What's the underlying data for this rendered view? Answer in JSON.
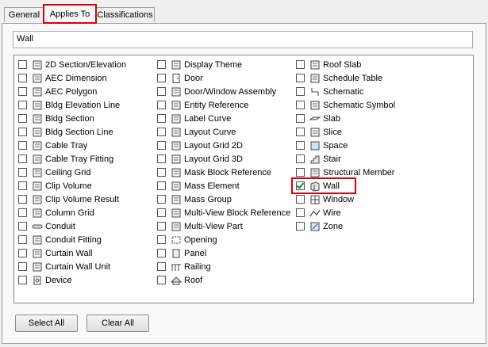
{
  "tabs": [
    "General",
    "Applies To",
    "Classifications"
  ],
  "filter_value": "Wall",
  "columns": [
    [
      {
        "label": "2D Section/Elevation",
        "icon": "section-elevation-icon",
        "checked": false
      },
      {
        "label": "AEC Dimension",
        "icon": "dimension-icon",
        "checked": false
      },
      {
        "label": "AEC Polygon",
        "icon": "polygon-icon",
        "checked": false
      },
      {
        "label": "Bldg Elevation Line",
        "icon": "elevation-line-icon",
        "checked": false
      },
      {
        "label": "Bldg Section",
        "icon": "bldg-section-icon",
        "checked": false
      },
      {
        "label": "Bldg Section Line",
        "icon": "section-line-icon",
        "checked": false
      },
      {
        "label": "Cable Tray",
        "icon": "cable-tray-icon",
        "checked": false
      },
      {
        "label": "Cable Tray Fitting",
        "icon": "cable-tray-fitting-icon",
        "checked": false
      },
      {
        "label": "Ceiling Grid",
        "icon": "ceiling-grid-icon",
        "checked": false
      },
      {
        "label": "Clip Volume",
        "icon": "clip-volume-icon",
        "checked": false
      },
      {
        "label": "Clip Volume Result",
        "icon": "clip-volume-result-icon",
        "checked": false
      },
      {
        "label": "Column Grid",
        "icon": "column-grid-icon",
        "checked": false
      },
      {
        "label": "Conduit",
        "icon": "conduit-icon",
        "checked": false
      },
      {
        "label": "Conduit Fitting",
        "icon": "conduit-fitting-icon",
        "checked": false
      },
      {
        "label": "Curtain Wall",
        "icon": "curtain-wall-icon",
        "checked": false
      },
      {
        "label": "Curtain Wall Unit",
        "icon": "curtain-wall-unit-icon",
        "checked": false
      },
      {
        "label": "Device",
        "icon": "device-icon",
        "checked": false
      }
    ],
    [
      {
        "label": "Display Theme",
        "icon": "display-theme-icon",
        "checked": false
      },
      {
        "label": "Door",
        "icon": "door-icon",
        "checked": false
      },
      {
        "label": "Door/Window Assembly",
        "icon": "door-window-assembly-icon",
        "checked": false
      },
      {
        "label": "Entity Reference",
        "icon": "entity-reference-icon",
        "checked": false
      },
      {
        "label": "Label Curve",
        "icon": "label-curve-icon",
        "checked": false
      },
      {
        "label": "Layout Curve",
        "icon": "layout-curve-icon",
        "checked": false
      },
      {
        "label": "Layout Grid 2D",
        "icon": "layout-grid-2d-icon",
        "checked": false
      },
      {
        "label": "Layout Grid 3D",
        "icon": "layout-grid-3d-icon",
        "checked": false
      },
      {
        "label": "Mask Block Reference",
        "icon": "mask-block-icon",
        "checked": false
      },
      {
        "label": "Mass Element",
        "icon": "mass-element-icon",
        "checked": false
      },
      {
        "label": "Mass Group",
        "icon": "mass-group-icon",
        "checked": false
      },
      {
        "label": "Multi-View Block Reference",
        "icon": "multi-view-block-icon",
        "checked": false
      },
      {
        "label": "Multi-View Part",
        "icon": "multi-view-part-icon",
        "checked": false
      },
      {
        "label": "Opening",
        "icon": "opening-icon",
        "checked": false
      },
      {
        "label": "Panel",
        "icon": "panel-icon",
        "checked": false
      },
      {
        "label": "Railing",
        "icon": "railing-icon",
        "checked": false
      },
      {
        "label": "Roof",
        "icon": "roof-icon",
        "checked": false
      }
    ],
    [
      {
        "label": "Roof Slab",
        "icon": "roof-slab-icon",
        "checked": false
      },
      {
        "label": "Schedule Table",
        "icon": "schedule-table-icon",
        "checked": false
      },
      {
        "label": "Schematic",
        "icon": "schematic-icon",
        "checked": false
      },
      {
        "label": "Schematic Symbol",
        "icon": "schematic-symbol-icon",
        "checked": false
      },
      {
        "label": "Slab",
        "icon": "slab-icon",
        "checked": false
      },
      {
        "label": "Slice",
        "icon": "slice-icon",
        "checked": false
      },
      {
        "label": "Space",
        "icon": "space-icon",
        "checked": false
      },
      {
        "label": "Stair",
        "icon": "stair-icon",
        "checked": false
      },
      {
        "label": "Structural Member",
        "icon": "structural-member-icon",
        "checked": false
      },
      {
        "label": "Wall",
        "icon": "wall-icon",
        "checked": true
      },
      {
        "label": "Window",
        "icon": "window-icon",
        "checked": false
      },
      {
        "label": "Wire",
        "icon": "wire-icon",
        "checked": false
      },
      {
        "label": "Zone",
        "icon": "zone-icon",
        "checked": false
      }
    ]
  ],
  "buttons": {
    "select_all": "Select All",
    "clear_all": "Clear All"
  },
  "colors": {
    "highlight": "#d8000e",
    "check": "#1d8a1d"
  }
}
